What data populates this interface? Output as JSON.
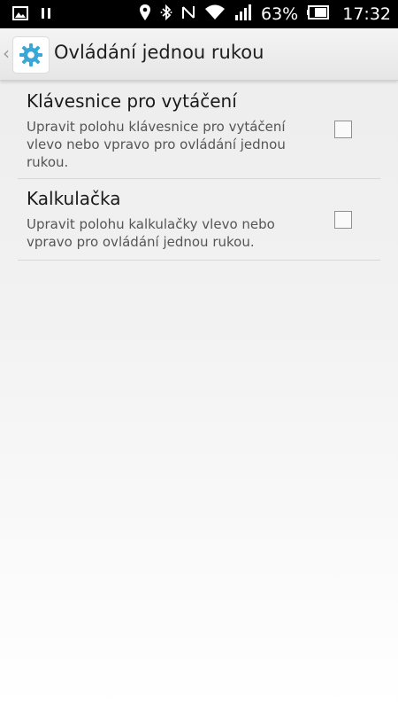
{
  "status_bar": {
    "battery_percent": "63%",
    "time": "17:32",
    "left_icons": [
      "image-icon",
      "pause-icon"
    ],
    "right_icons": [
      "location-icon",
      "bluetooth-icon",
      "nfc-icon",
      "wifi-icon",
      "signal-icon",
      "battery-icon"
    ]
  },
  "app_bar": {
    "title": "Ovládání jednou rukou",
    "icon": "gear-icon",
    "accent_color": "#3aa7d6"
  },
  "settings": [
    {
      "title": "Klávesnice pro vytáčení",
      "description": "Upravit polohu klávesnice pro vytáčení vlevo nebo vpravo pro ovládání jednou rukou.",
      "checked": false
    },
    {
      "title": "Kalkulačka",
      "description": "Upravit polohu kalkulačky vlevo nebo vpravo pro ovládání jednou rukou.",
      "checked": false
    }
  ]
}
